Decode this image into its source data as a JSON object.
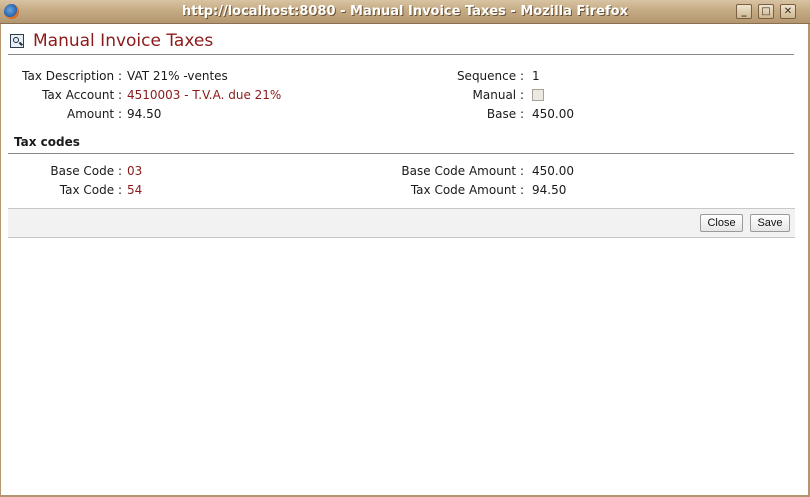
{
  "window": {
    "title": "http://localhost:8080 - Manual Invoice Taxes - Mozilla Firefox",
    "minimize": "_",
    "maximize": "□",
    "close": "✕"
  },
  "page": {
    "title": "Manual Invoice Taxes"
  },
  "form": {
    "tax_description_label": "Tax Description :",
    "tax_description_value": "VAT 21% -ventes",
    "tax_account_label": "Tax Account :",
    "tax_account_value": "4510003 - T.V.A. due 21%",
    "amount_label": "Amount :",
    "amount_value": "94.50",
    "sequence_label": "Sequence :",
    "sequence_value": "1",
    "manual_label": "Manual :",
    "manual_checked": false,
    "base_label": "Base :",
    "base_value": "450.00"
  },
  "tax_codes": {
    "section_title": "Tax codes",
    "base_code_label": "Base Code :",
    "base_code_value": "03",
    "tax_code_label": "Tax Code :",
    "tax_code_value": "54",
    "base_code_amount_label": "Base Code Amount :",
    "base_code_amount_value": "450.00",
    "tax_code_amount_label": "Tax Code Amount :",
    "tax_code_amount_value": "94.50"
  },
  "buttons": {
    "close": "Close",
    "save": "Save"
  },
  "colors": {
    "title_red": "#8b1a1a",
    "link_red": "#8b1a1a",
    "titlebar": "#c5ab83"
  }
}
